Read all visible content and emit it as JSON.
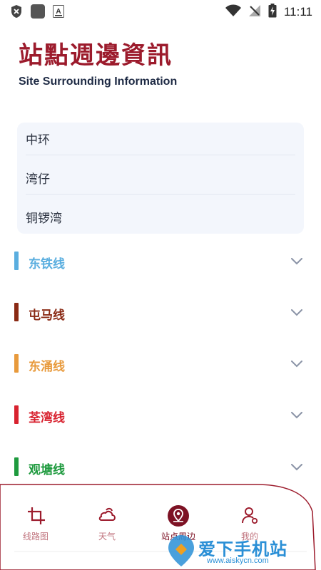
{
  "status_bar": {
    "time": "11:11",
    "icons": [
      "shield-icon",
      "app-square-icon",
      "keyboard-a-icon",
      "wifi-icon",
      "no-signal-icon",
      "battery-charging-icon"
    ]
  },
  "header": {
    "title_cn": "站點週邊資訊",
    "title_en": "Site Surrounding Information"
  },
  "stations": [
    "中环",
    "湾仔",
    "铜锣湾"
  ],
  "lines": [
    {
      "label": "东铁线",
      "color": "#5aaedf"
    },
    {
      "label": "屯马线",
      "color": "#8a2a14"
    },
    {
      "label": "东涌线",
      "color": "#e89a3c"
    },
    {
      "label": "荃湾线",
      "color": "#d8222f"
    },
    {
      "label": "观塘线",
      "color": "#1e9a3e"
    }
  ],
  "tabs": [
    {
      "label": "线路图",
      "icon": "crop-grid-icon",
      "active": false
    },
    {
      "label": "天气",
      "icon": "weather-cloud-icon",
      "active": false
    },
    {
      "label": "站点周边",
      "icon": "location-pin-icon",
      "active": true
    },
    {
      "label": "我的",
      "icon": "user-settings-icon",
      "active": false
    }
  ],
  "colors": {
    "brand": "#9c1b2c",
    "tab_inactive": "#c0737d",
    "card_bg": "#f3f6fc"
  },
  "watermark": {
    "text": "爱下手机站",
    "url": "www.aiskycn.com"
  }
}
